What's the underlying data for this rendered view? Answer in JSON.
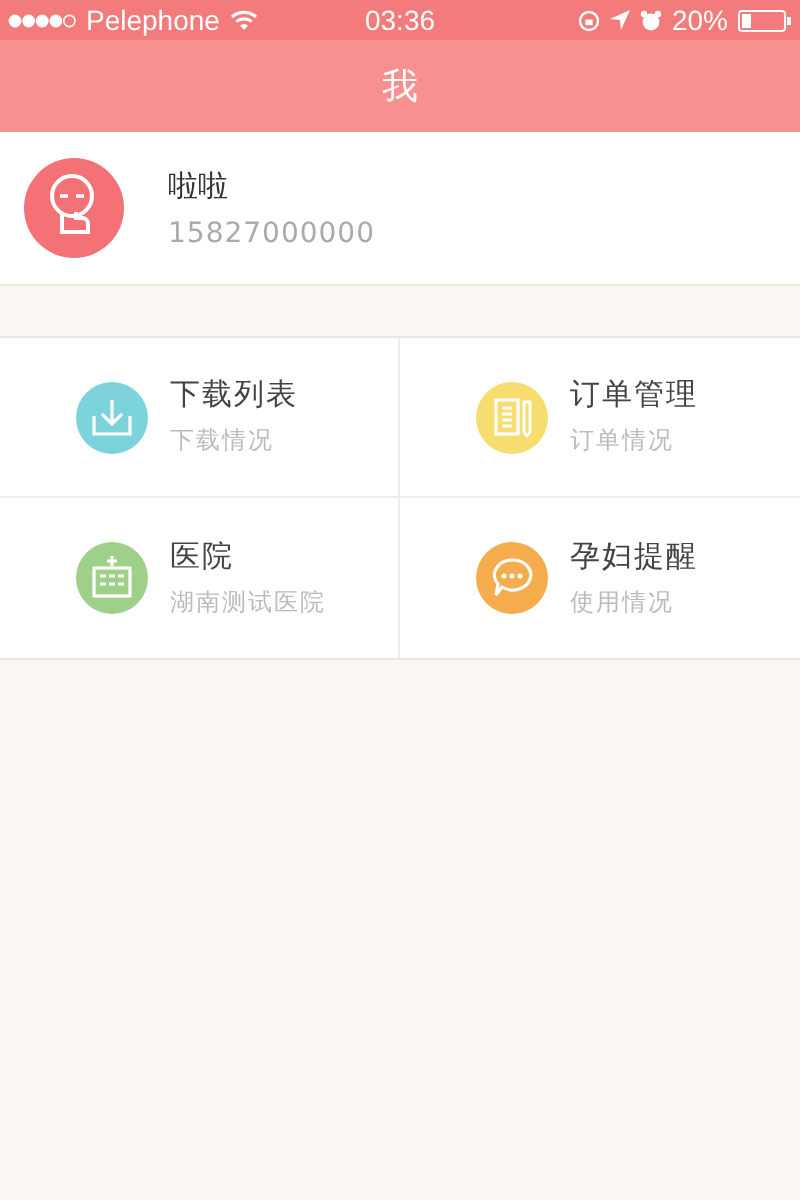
{
  "status_bar": {
    "carrier": "Pelephone",
    "time": "03:36",
    "battery": "20%"
  },
  "nav_bar": {
    "title": "我"
  },
  "profile": {
    "name": "啦啦",
    "phone": "15827000000"
  },
  "menu": [
    {
      "title": "下载列表",
      "subtitle": "下载情况",
      "color": "#7dd3dc"
    },
    {
      "title": "订单管理",
      "subtitle": "订单情况",
      "color": "#f7dc6f"
    },
    {
      "title": "医院",
      "subtitle": "湖南测试医院",
      "color": "#9fd08a"
    },
    {
      "title": "孕妇提醒",
      "subtitle": "使用情况",
      "color": "#f5ac4c"
    }
  ]
}
